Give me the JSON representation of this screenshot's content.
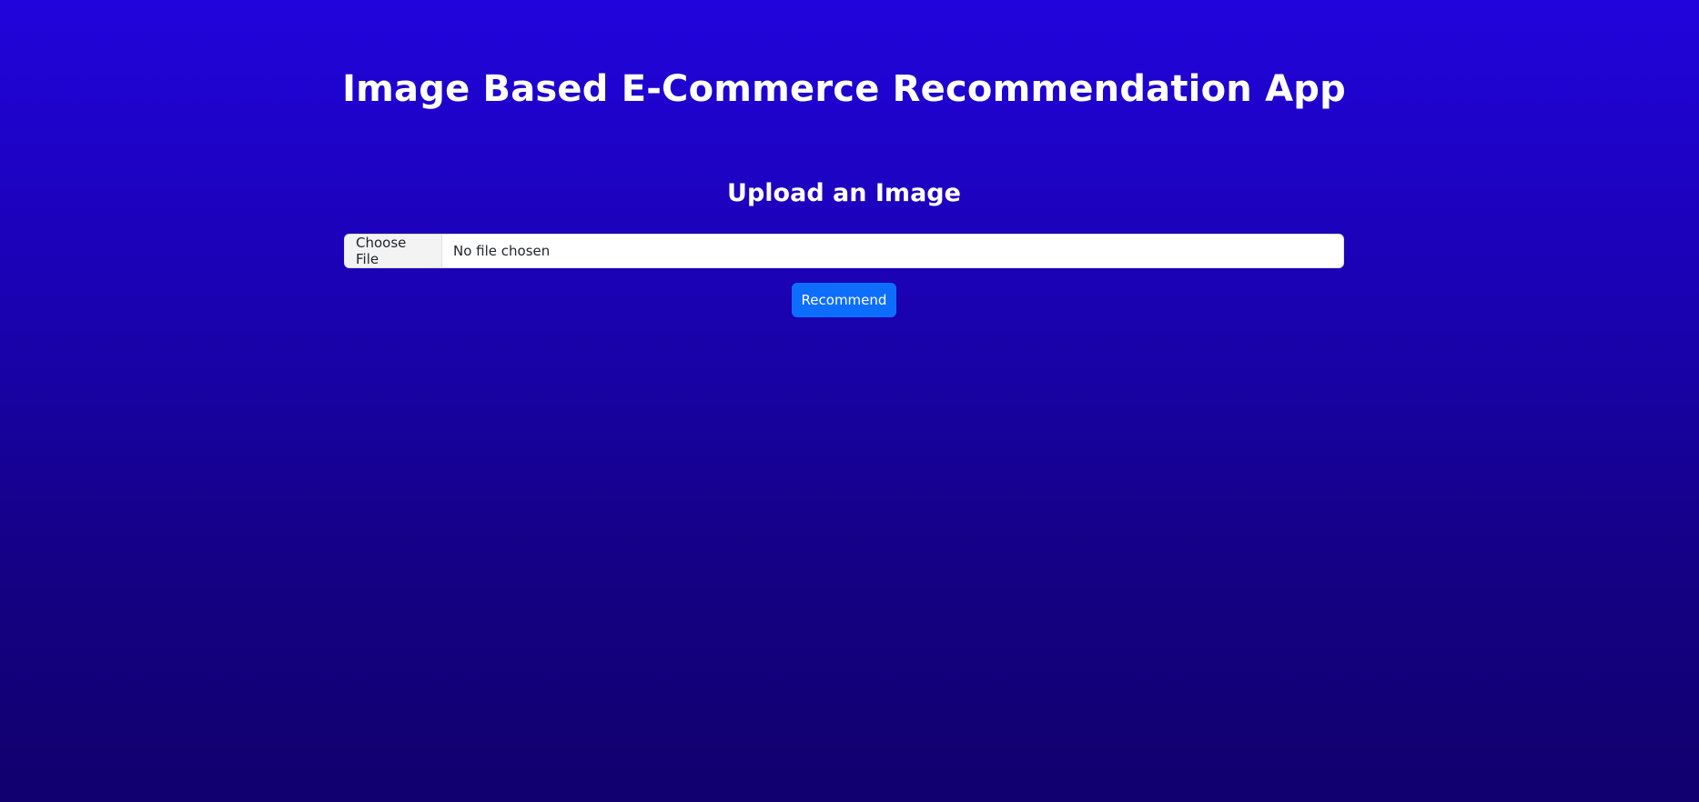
{
  "header": {
    "title": "Image Based E-Commerce Recommendation App"
  },
  "upload": {
    "heading": "Upload an Image",
    "choose_file_label": "Choose File",
    "file_status": "No file chosen",
    "submit_label": "Recommend"
  },
  "colors": {
    "background_top": "#2104dc",
    "background_bottom": "#11006e",
    "primary_button": "#0d6efd"
  }
}
